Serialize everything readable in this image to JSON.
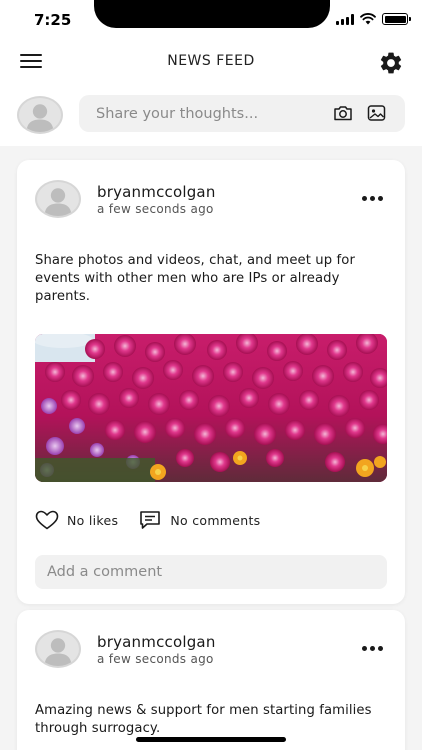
{
  "status_bar": {
    "time": "7:25"
  },
  "header": {
    "title": "NEWS FEED"
  },
  "composer": {
    "placeholder": "Share your thoughts..."
  },
  "posts": [
    {
      "username": "bryanmccolgan",
      "timestamp": "a few seconds ago",
      "text": "Share photos and videos, chat, and meet up for events with other men who are IPs or already parents.",
      "likes_label": "No likes",
      "comments_label": "No comments",
      "comment_placeholder": "Add a comment"
    },
    {
      "username": "bryanmccolgan",
      "timestamp": "a few seconds ago",
      "text": "Amazing news & support for men starting families through surrogacy."
    }
  ]
}
